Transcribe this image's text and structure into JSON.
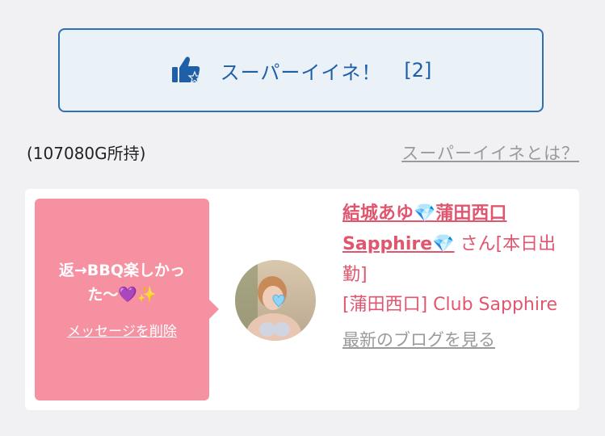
{
  "super_like": {
    "label": "スーパーイイネ！",
    "count": "[2]",
    "icon": "thumbs-up-star-icon",
    "color": "#1f5fa8"
  },
  "holdings": "(107080G所持)",
  "what_is_link": "スーパーイイネとは？",
  "message": {
    "text": "返→BBQ楽しかった〜💜✨",
    "delete_label": "メッセージを削除",
    "bubble_color": "#f691a2"
  },
  "cast": {
    "name": "結城あゆ💎蒲田西口Sapphire💎",
    "suffix": "さん[本日出勤]",
    "shop": "[蒲田西口] Club Sapphire",
    "blog_link": "最新のブログを見る",
    "accent_color": "#e0566f"
  },
  "avatar": {
    "icon": "blue-heart-icon"
  }
}
